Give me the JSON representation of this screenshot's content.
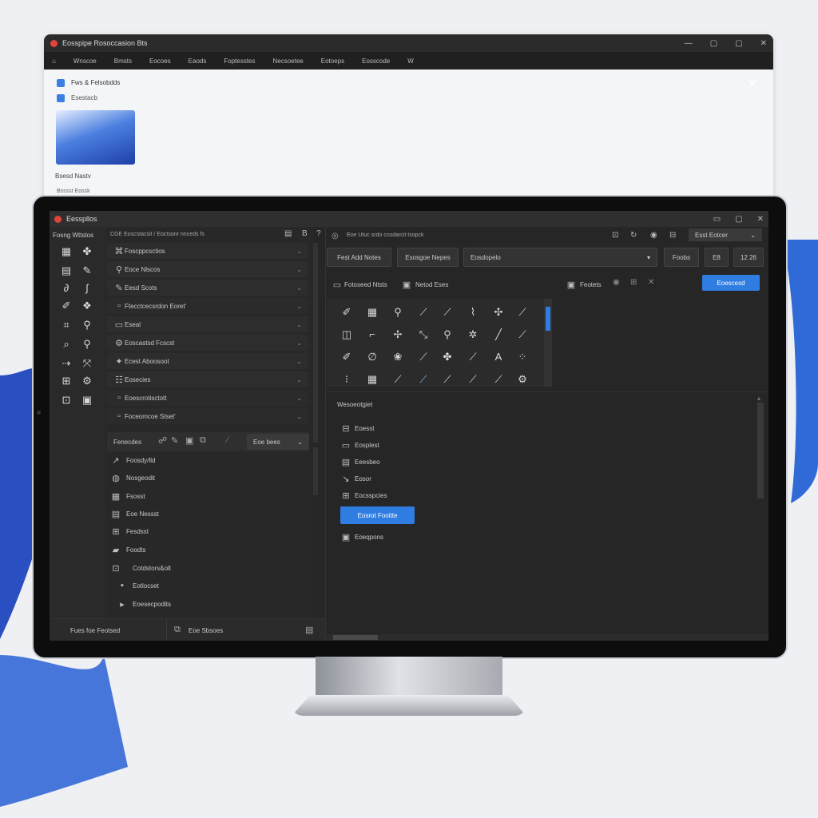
{
  "bg_window": {
    "title": "Eosspipe Rosoccasion Bts",
    "menu": [
      "Wnscoe",
      "Bmsts",
      "Eocoes",
      "Eaods",
      "Foptesstes",
      "Necsoetee",
      "Eotoeps",
      "Eosscode",
      "W"
    ],
    "panel_item1": "Fws & Felsobdds",
    "panel_item2": "Esestacb",
    "panel_label": "Bsesd Nastv",
    "panel_label2": "Bsssst Eossk"
  },
  "app": {
    "title": "Eesspllos",
    "sidebar_title": "Fosng Wttstos",
    "breadcrumb": "CGE   Eoscstacsit / Eoctsonr nnceds fs",
    "tree_items": [
      "Foscppcsctios",
      "Eoce Nlscos",
      "Eesd Scots",
      "Ftecctcecsrdon Eoret'",
      "Eseal",
      "Eoscastsd Fcscst",
      "Ecest Aboosoot",
      "Eosecies",
      "Eoescrotisctott",
      "Foceomcoe Stset'"
    ],
    "props_header": "Fenecdes",
    "props_dropdown": "Eoe bees",
    "props_items": [
      "Foosdy/lld",
      "Nosgeodit",
      "Fsosst",
      "Eoe Nessst",
      "Fesdsst",
      "Foodts",
      "Cotdstors&olt",
      "Eotlocset",
      "Eoesecpodits"
    ],
    "status_left": "Fues foe Feotsed",
    "status_mid": "Eoe Sbsoes",
    "toolbar_path": "Eoe Utuc srdo ccodarcit tsopck",
    "toolbar_dropdown": "Esst Eotcer",
    "btn_fast": "Fest Add Notes",
    "btn_stage": "Esosgoe Nepes",
    "select_value": "Eosdopelo",
    "btn_fooks": "Foobs",
    "btn_e": "E8",
    "btn_zoom": "12 26",
    "sub_left": "Fotoseed Ntsts",
    "sub_mid": "Netod Eses",
    "sub_right": "Feotets",
    "btn_primary": "Eoescesd",
    "section_title": "Wesoeotgiet",
    "section_items": [
      "Eoesst",
      "Eosplest",
      "Eeesbeo",
      "Eosor",
      "Eocsspcies"
    ],
    "section_button": "Eosrot Fooitte",
    "section_last": "Eoeqpons"
  },
  "colors": {
    "accent": "#2f7de1",
    "dark_bg": "#262626",
    "panel": "#2d2d2d"
  },
  "icons": [
    "pencil-icon",
    "grid-icon",
    "brush-icon",
    "pen-icon",
    "crop-icon",
    "move-icon",
    "line-icon",
    "eyedropper-icon",
    "square-icon",
    "text-icon",
    "stamp-icon",
    "eraser-icon",
    "gear-icon",
    "search-icon"
  ]
}
